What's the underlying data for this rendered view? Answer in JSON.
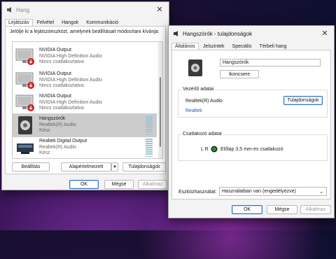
{
  "sound_window": {
    "title": "Hang",
    "tabs": [
      "Lejátszás",
      "Felvétel",
      "Hangok",
      "Kommunikáció"
    ],
    "instruction": "Jelölje ki a lejátszóeszközt, amelynek beállításait módosítani kívánja:",
    "devices": [
      {
        "name": "NVIDIA Output",
        "driver": "NVIDIA High Definition Audio",
        "status": "Nincs csatlakoztatva",
        "icon": "monitor-disconnected-icon"
      },
      {
        "name": "NVIDIA Output",
        "driver": "NVIDIA High Definition Audio",
        "status": "Nincs csatlakoztatva",
        "icon": "monitor-disconnected-icon"
      },
      {
        "name": "NVIDIA Output",
        "driver": "NVIDIA High Definition Audio",
        "status": "Nincs csatlakoztatva",
        "icon": "monitor-disconnected-icon"
      },
      {
        "name": "Hangszórók",
        "driver": "Realtek(R) Audio",
        "status": "Kész",
        "icon": "speaker-icon",
        "selected": true
      },
      {
        "name": "Realtek Digital Output",
        "driver": "Realtek(R) Audio",
        "status": "Kész",
        "icon": "digital-output-icon"
      }
    ],
    "buttons": {
      "configure": "Beállítás",
      "set_default": "Alapértelmezett",
      "properties": "Tulajdonságok",
      "ok": "OK",
      "cancel": "Mégse",
      "apply": "Alkalmaz"
    }
  },
  "props_window": {
    "title": "Hangszórók - tulajdonságok",
    "tabs": [
      "Általános",
      "Jelszintek",
      "Speciális",
      "Térbeli hang"
    ],
    "device_name": "Hangszórók",
    "change_icon": "Ikoncsere",
    "controller_group": "Vezérlő adatai",
    "controller_name": "Realtek(R) Audio",
    "controller_properties": "Tulajdonságok",
    "controller_link": "Realtek",
    "jack_group": "Csatlakozó adatai",
    "jack_lr": "L R",
    "jack_text": "Előlap 3,5 mm-es csatlakozó",
    "device_usage_label": "Eszközhasználat:",
    "device_usage_value": "Használatban van (engedélyezve)",
    "buttons": {
      "ok": "OK",
      "cancel": "Mégse",
      "apply": "Alkalmaz"
    }
  },
  "colors": {
    "accent": "#2b6cc4",
    "jack_green": "#1f9a2a",
    "disconnected_red": "#d32020",
    "selected_row": "#cccccc"
  }
}
